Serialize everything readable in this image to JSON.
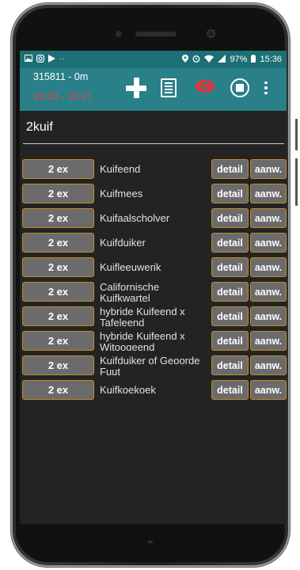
{
  "statusbar": {
    "left_icons": [
      "image-icon",
      "instagram-icon",
      "play-store-icon",
      "more-icon"
    ],
    "right_icons": [
      "location-icon",
      "alarm-icon",
      "wifi-icon",
      "signal-icon"
    ],
    "battery": "97%",
    "time": "15:36"
  },
  "appbar": {
    "session_id": "315811 - 0m",
    "session_time": "15:03 - 15:17",
    "actions": [
      "plus-icon",
      "document-icon",
      "eye-icon",
      "stop-icon",
      "overflow-menu-icon"
    ],
    "eye_color": "#e8333a",
    "bar_color": "#2a8088"
  },
  "search": {
    "value": "2kuif"
  },
  "rows": [
    {
      "count": "2 ex",
      "species": "Kuifeend",
      "detail": "detail",
      "aanw": "aanw."
    },
    {
      "count": "2 ex",
      "species": "Kuifmees",
      "detail": "detail",
      "aanw": "aanw."
    },
    {
      "count": "2 ex",
      "species": "Kuifaalscholver",
      "detail": "detail",
      "aanw": "aanw."
    },
    {
      "count": "2 ex",
      "species": "Kuifduiker",
      "detail": "detail",
      "aanw": "aanw."
    },
    {
      "count": "2 ex",
      "species": "Kuifleeuwerik",
      "detail": "detail",
      "aanw": "aanw."
    },
    {
      "count": "2 ex",
      "species": "Californische Kuifkwartel",
      "detail": "detail",
      "aanw": "aanw."
    },
    {
      "count": "2 ex",
      "species": "hybride Kuifeend x Tafeleend",
      "detail": "detail",
      "aanw": "aanw."
    },
    {
      "count": "2 ex",
      "species": "hybride Kuifeend x Witoogeend",
      "detail": "detail",
      "aanw": "aanw."
    },
    {
      "count": "2 ex",
      "species": "Kuifduiker of Geoorde Fuut",
      "detail": "detail",
      "aanw": "aanw."
    },
    {
      "count": "2 ex",
      "species": "Kuifkoekoek",
      "detail": "detail",
      "aanw": "aanw."
    }
  ]
}
